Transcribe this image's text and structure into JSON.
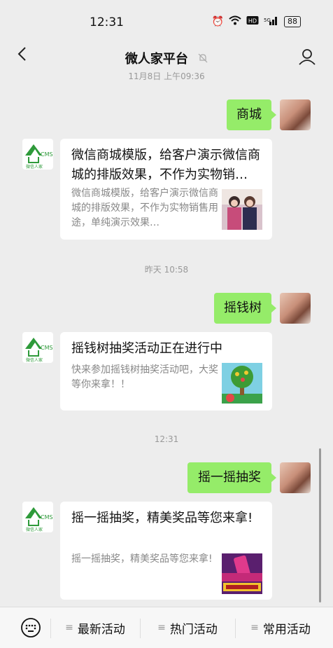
{
  "status_bar": {
    "time": "12:31",
    "battery": "88"
  },
  "header": {
    "title": "微人家平台",
    "back_glyph": "‹"
  },
  "messages": {
    "ts_top": "11月8日 上午09:36",
    "sent1": "商城",
    "card1": {
      "title": "微信商城模版，给客户演示微信商城的排版效果，不作为实物销…",
      "desc": "微信商城模版，给客户演示微信商城的排版效果，不作为实物销售用途，单纯演示效果…"
    },
    "ts_yesterday": "昨天 10:58",
    "sent2": "摇钱树",
    "card2": {
      "title": "摇钱树抽奖活动正在进行中",
      "desc": "快来参加摇钱树抽奖活动吧，大奖等你来拿！！"
    },
    "ts_today": "12:31",
    "sent3": "摇一摇抽奖",
    "card3": {
      "title": "摇一摇抽奖，精美奖品等您来拿!",
      "desc": "摇一摇抽奖，精美奖品等您来拿!"
    }
  },
  "logo": {
    "text_top": "CMS",
    "text_bottom": "微信人家"
  },
  "bottom_menu": {
    "items": [
      "最新活动",
      "热门活动",
      "常用活动"
    ],
    "menu_glyph": "≡"
  },
  "icons": [
    "back-icon",
    "mute-bell-icon",
    "profile-icon",
    "keyboard-icon",
    "menu-lines-icon"
  ],
  "colors": {
    "bubble_green": "#95ec69",
    "background": "#ededed"
  }
}
